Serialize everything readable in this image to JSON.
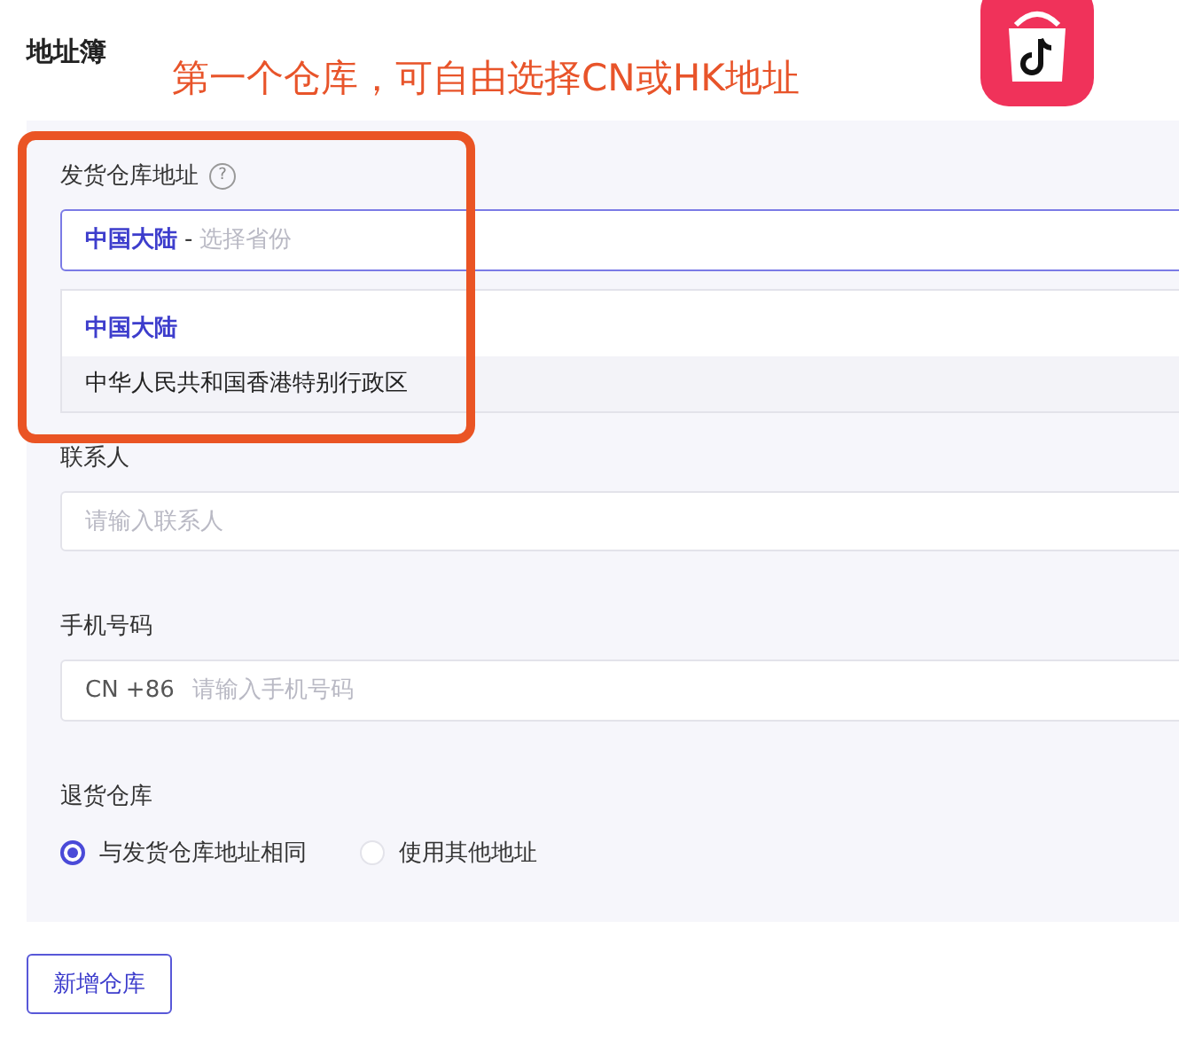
{
  "page_title": "地址簿",
  "annotation": {
    "text": "第一个仓库，可自由选择CN或HK地址"
  },
  "form": {
    "warehouse_address": {
      "label": "发货仓库地址",
      "help": "?",
      "value": "中国大陆",
      "separator": "-",
      "placeholder": "选择省份",
      "options": [
        {
          "label": "中国大陆",
          "selected": true,
          "hovered": false
        },
        {
          "label": "中华人民共和国香港特别行政区",
          "selected": false,
          "hovered": true
        }
      ]
    },
    "contact": {
      "label": "联系人",
      "placeholder": "请输入联系人"
    },
    "phone": {
      "label": "手机号码",
      "prefix": "CN +86",
      "placeholder": "请输入手机号码"
    },
    "return_warehouse": {
      "label": "退货仓库",
      "options": [
        {
          "label": "与发货仓库地址相同",
          "selected": true
        },
        {
          "label": "使用其他地址",
          "selected": false
        }
      ]
    }
  },
  "add_button": "新增仓库"
}
